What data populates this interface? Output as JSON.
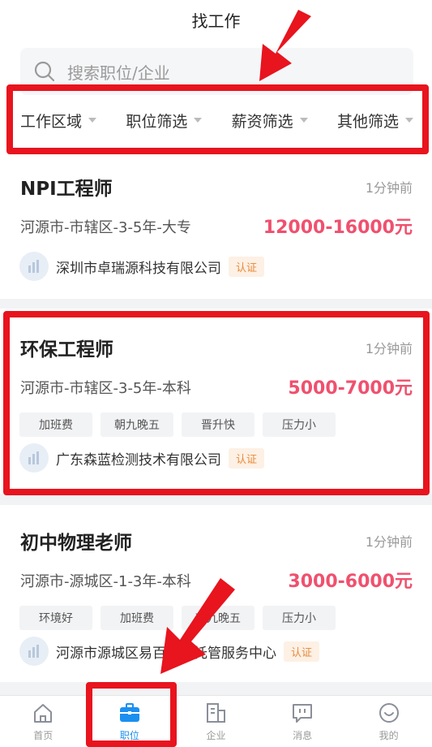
{
  "header": {
    "title": "找工作"
  },
  "search": {
    "placeholder": "搜索职位/企业"
  },
  "filters": [
    {
      "label": "工作区域"
    },
    {
      "label": "职位筛选"
    },
    {
      "label": "薪资筛选"
    },
    {
      "label": "其他筛选"
    }
  ],
  "jobs": [
    {
      "title": "NPI工程师",
      "time": "1分钟前",
      "location": "河源市-市辖区-3-5年-大专",
      "salary": "12000-16000元",
      "tags": [],
      "company": "深圳市卓瑞源科技有限公司",
      "badge": "认证"
    },
    {
      "title": "环保工程师",
      "time": "1分钟前",
      "location": "河源市-市辖区-3-5年-本科",
      "salary": "5000-7000元",
      "tags": [
        "加班费",
        "朝九晚五",
        "晋升快",
        "压力小"
      ],
      "company": "广东森蓝检测技术有限公司",
      "badge": "认证"
    },
    {
      "title": "初中物理老师",
      "time": "1分钟前",
      "location": "河源市-源城区-1-3年-本科",
      "salary": "3000-6000元",
      "tags": [
        "环境好",
        "加班费",
        "朝九晚五",
        "压力小"
      ],
      "company": "河源市源城区易百学生托管服务中心",
      "badge": "认证"
    }
  ],
  "tabbar": {
    "active": "职位",
    "items": [
      {
        "label": "首页",
        "icon": "home-icon"
      },
      {
        "label": "职位",
        "icon": "briefcase-icon"
      },
      {
        "label": "企业",
        "icon": "building-icon"
      },
      {
        "label": "消息",
        "icon": "message-icon"
      },
      {
        "label": "我的",
        "icon": "profile-icon"
      }
    ]
  },
  "colors": {
    "salary": "#f0506e",
    "accent": "#1b8ff0",
    "annotation": "#e8141e",
    "badge": "#e88a3a"
  }
}
